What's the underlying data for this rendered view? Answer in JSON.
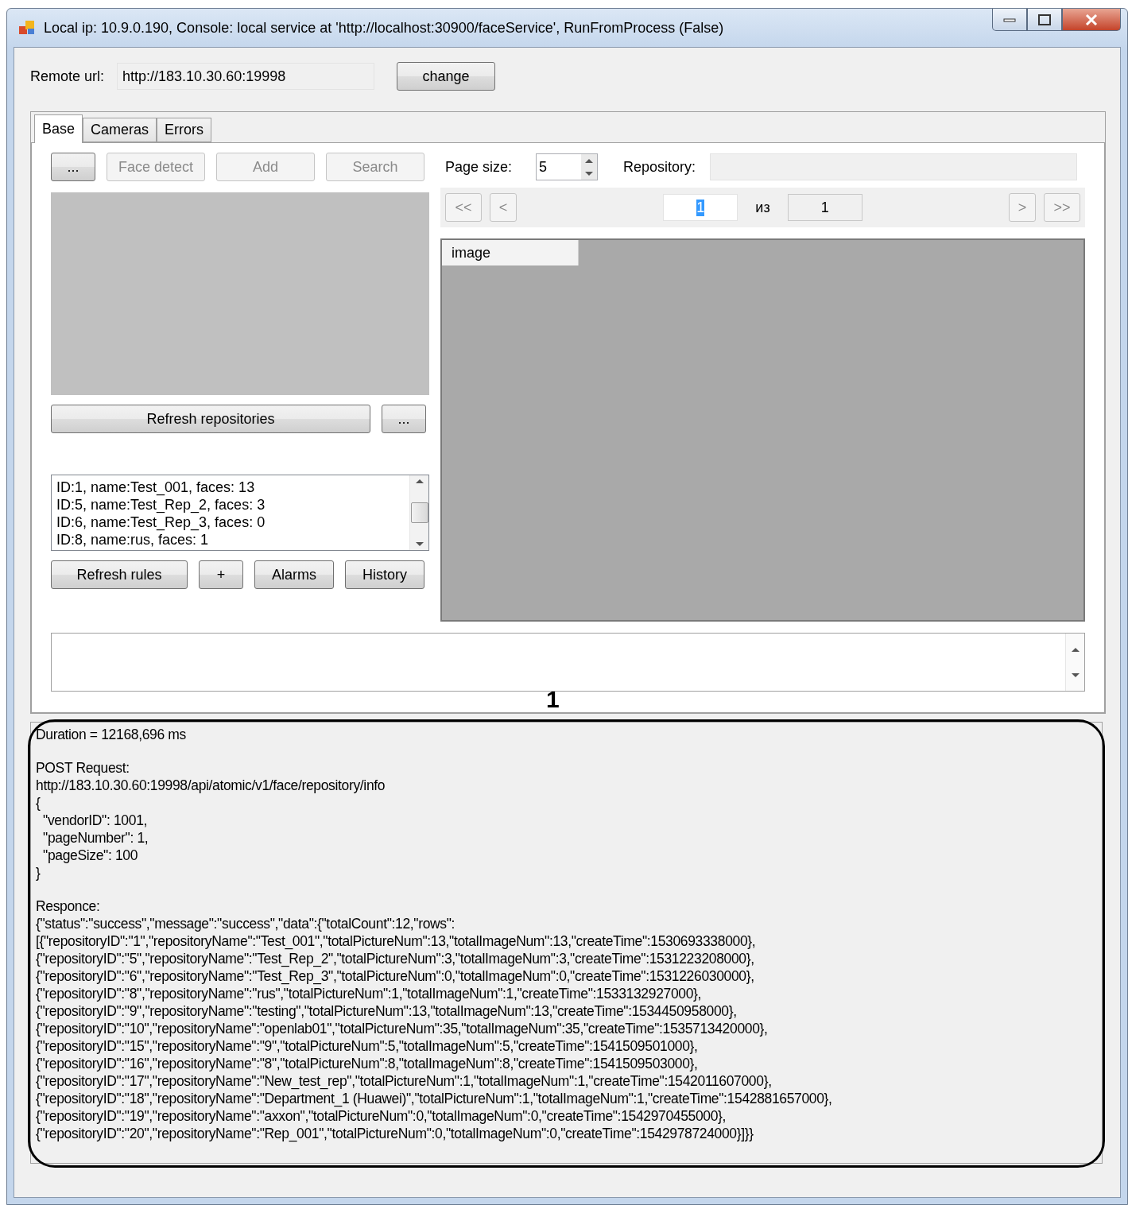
{
  "window": {
    "title": "Local ip: 10.9.0.190, Console: local service at 'http://localhost:30900/faceService', RunFromProcess (False)"
  },
  "remote": {
    "label": "Remote url:",
    "value": "http://183.10.30.60:19998",
    "button": "change"
  },
  "tabs": [
    {
      "label": "Base",
      "selected": true
    },
    {
      "label": "Cameras",
      "selected": false
    },
    {
      "label": "Errors",
      "selected": false
    }
  ],
  "toolbar": [
    {
      "label": "...",
      "disabled": false
    },
    {
      "label": "Face detect",
      "disabled": true
    },
    {
      "label": "Add",
      "disabled": true
    },
    {
      "label": "Search",
      "disabled": true
    }
  ],
  "refresh_repositories": {
    "label": "Refresh repositories",
    "more": "..."
  },
  "repositories": [
    "ID:1, name:Test_001, faces: 13",
    "ID:5, name:Test_Rep_2, faces: 3",
    "ID:6, name:Test_Rep_3, faces: 0",
    "ID:8, name:rus, faces: 1"
  ],
  "rule_buttons": [
    {
      "label": "Refresh rules",
      "disabled": false
    },
    {
      "label": "+",
      "disabled": false
    },
    {
      "label": "Alarms",
      "disabled": false
    },
    {
      "label": "History",
      "disabled": false
    }
  ],
  "paging": {
    "page_size_label": "Page size:",
    "page_size": "5",
    "repository_label": "Repository:",
    "nav_left": [
      {
        "label": "<<",
        "disabled": true
      },
      {
        "label": "<",
        "disabled": true
      }
    ],
    "page": "1",
    "of_label": "из",
    "total": "1",
    "nav_right": [
      {
        "label": ">",
        "disabled": true
      },
      {
        "label": ">>",
        "disabled": true
      }
    ]
  },
  "grid": {
    "columns": [
      "image"
    ]
  },
  "log": [
    [
      "Duration = 12168,696 ms"
    ],
    [
      "POST Request:",
      "http://183.10.30.60:19998/api/atomic/v1/face/repository/info",
      "{",
      "  \"vendorID\": 1001,",
      "  \"pageNumber\": 1,",
      "  \"pageSize\": 100",
      "}"
    ],
    [
      "Responce:",
      "{\"status\":\"success\",\"message\":\"success\",\"data\":{\"totalCount\":12,\"rows\":",
      "[{\"repositoryID\":\"1\",\"repositoryName\":\"Test_001\",\"totalPictureNum\":13,\"totalImageNum\":13,\"createTime\":1530693338000},",
      "{\"repositoryID\":\"5\",\"repositoryName\":\"Test_Rep_2\",\"totalPictureNum\":3,\"totalImageNum\":3,\"createTime\":1531223208000},",
      "{\"repositoryID\":\"6\",\"repositoryName\":\"Test_Rep_3\",\"totalPictureNum\":0,\"totalImageNum\":0,\"createTime\":1531226030000},",
      "{\"repositoryID\":\"8\",\"repositoryName\":\"rus\",\"totalPictureNum\":1,\"totalImageNum\":1,\"createTime\":1533132927000},",
      "{\"repositoryID\":\"9\",\"repositoryName\":\"testing\",\"totalPictureNum\":13,\"totalImageNum\":13,\"createTime\":1534450958000},",
      "{\"repositoryID\":\"10\",\"repositoryName\":\"openlab01\",\"totalPictureNum\":35,\"totalImageNum\":35,\"createTime\":1535713420000},",
      "{\"repositoryID\":\"15\",\"repositoryName\":\"9\",\"totalPictureNum\":5,\"totalImageNum\":5,\"createTime\":1541509501000},",
      "{\"repositoryID\":\"16\",\"repositoryName\":\"8\",\"totalPictureNum\":8,\"totalImageNum\":8,\"createTime\":1541509503000},",
      "{\"repositoryID\":\"17\",\"repositoryName\":\"New_test_rep\",\"totalPictureNum\":1,\"totalImageNum\":1,\"createTime\":1542011607000},",
      "{\"repositoryID\":\"18\",\"repositoryName\":\"Department_1 (Huawei)\",\"totalPictureNum\":1,\"totalImageNum\":1,\"createTime\":1542881657000},",
      "{\"repositoryID\":\"19\",\"repositoryName\":\"axxon\",\"totalPictureNum\":0,\"totalImageNum\":0,\"createTime\":1542970455000},",
      "{\"repositoryID\":\"20\",\"repositoryName\":\"Rep_001\",\"totalPictureNum\":0,\"totalImageNum\":0,\"createTime\":1542978724000}]}}"
    ]
  ],
  "annotation": {
    "label": "1"
  }
}
